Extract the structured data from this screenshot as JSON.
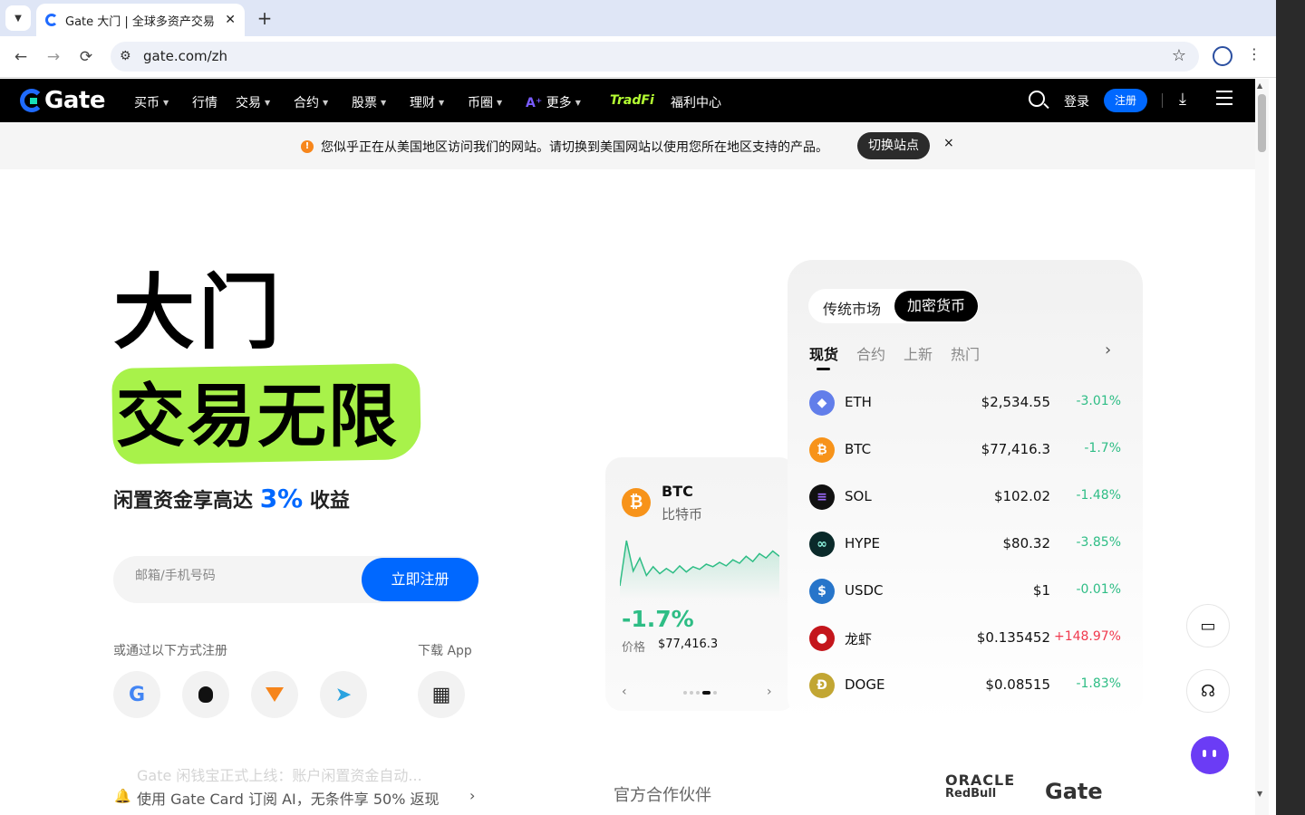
{
  "browser": {
    "tab_title": "Gate 大门 | 全球多资产交易",
    "tab_close": "✕",
    "new_tab": "+",
    "url": "gate.com/zh",
    "back": "←",
    "forward": "→",
    "reload": "⟳",
    "star": "☆",
    "kebab": "⋮"
  },
  "header": {
    "logo_text": "Gate",
    "nav": [
      {
        "label": "买币",
        "caret": true
      },
      {
        "label": "行情",
        "caret": false
      },
      {
        "label": "交易",
        "caret": true
      },
      {
        "label": "合约",
        "caret": true
      },
      {
        "label": "股票",
        "caret": true
      },
      {
        "label": "理财",
        "caret": true
      },
      {
        "label": "币圈",
        "caret": true
      },
      {
        "label": "更多",
        "caret": true,
        "prefix": "A⁺"
      },
      {
        "label": "TradFi",
        "caret": false
      },
      {
        "label": "福利中心",
        "caret": false
      }
    ],
    "login": "登录",
    "register": "注册",
    "caret_glyph": "▼"
  },
  "notice": {
    "icon": "!",
    "text": "您似乎正在从美国地区访问我们的网站。请切换到美国网站以使用您所在地区支持的产品。",
    "switch_label": "切换站点",
    "close": "×"
  },
  "hero": {
    "line1": "大门",
    "line2": "交易无限",
    "sub_prefix": "闲置资金享高达",
    "sub_pct": "3%",
    "sub_suffix": "收益",
    "input_placeholder": "邮箱/手机号码",
    "signup_button": "立即注册",
    "alt_signup_label": "或通过以下方式注册",
    "download_app_label": "下载 App",
    "social": [
      {
        "icon": "google-icon",
        "glyph": "G",
        "color": "#4285f4"
      },
      {
        "icon": "apple-icon",
        "glyph": "",
        "color": "#111111"
      },
      {
        "icon": "metamask-icon",
        "glyph": "🦊",
        "color": "#f6851b"
      },
      {
        "icon": "telegram-icon",
        "glyph": "➤",
        "color": "#2aa3e0"
      }
    ],
    "qr_glyph": "▦",
    "ticker_faded": "Gate 闲钱宝正式上线：账户闲置资金自动...",
    "ticker": "使用 Gate Card 订阅 AI，无条件享 50% 返现",
    "ticker_bell": "🔔",
    "ticker_arrow": "›"
  },
  "btc_card": {
    "symbol": "BTC",
    "name": "比特币",
    "coin_glyph": "₿",
    "change": "-1.7%",
    "price_label": "价格",
    "price": "$77,416.3",
    "prev": "‹",
    "next": "›",
    "sparkline": [
      72,
      20,
      55,
      40,
      60,
      50,
      58,
      52,
      57,
      49,
      56,
      50,
      53,
      47,
      50,
      45,
      49,
      42,
      46,
      38,
      44,
      35,
      40,
      32,
      38
    ]
  },
  "market": {
    "toggle_traditional": "传统市场",
    "toggle_crypto": "加密货币",
    "subtabs": [
      "现货",
      "合约",
      "上新",
      "热门"
    ],
    "more_arrow": "›",
    "rows": [
      {
        "symbol": "ETH",
        "price": "$2,534.55",
        "change": "-3.01%",
        "dir": "down",
        "color": "#627eea",
        "glyph": "◆"
      },
      {
        "symbol": "BTC",
        "price": "$77,416.3",
        "change": "-1.7%",
        "dir": "down",
        "color": "#f7931a",
        "glyph": "₿"
      },
      {
        "symbol": "SOL",
        "price": "$102.02",
        "change": "-1.48%",
        "dir": "down",
        "color": "#111111",
        "glyph": "≡"
      },
      {
        "symbol": "HYPE",
        "price": "$80.32",
        "change": "-3.85%",
        "dir": "down",
        "color": "#0a2a2a",
        "glyph": "∞"
      },
      {
        "symbol": "USDC",
        "price": "$1",
        "change": "-0.01%",
        "dir": "down",
        "color": "#2775ca",
        "glyph": "$"
      },
      {
        "symbol": "龙虾",
        "price": "$0.135452",
        "change": "+148.97%",
        "dir": "up",
        "color": "#c4161c",
        "glyph": "●"
      },
      {
        "symbol": "DOGE",
        "price": "$0.08515",
        "change": "-1.83%",
        "dir": "down",
        "color": "#c2a633",
        "glyph": "Ð"
      }
    ]
  },
  "partners": {
    "label": "官方合作伙伴",
    "oracle": "ORACLE",
    "redbull": "RedBull",
    "gate": "Gate"
  },
  "fabs": {
    "wallet_glyph": "▭",
    "support_glyph": "☊"
  }
}
